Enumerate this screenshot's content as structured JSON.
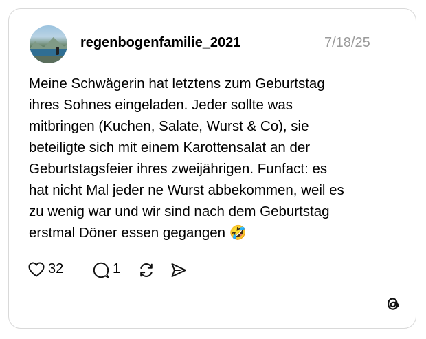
{
  "post": {
    "username": "regenbogenfamilie_2021",
    "date": "7/18/25",
    "text_lines": [
      "Meine Schwägerin hat letztens zum Geburtstag",
      "ihres Sohnes eingeladen. Jeder sollte was",
      "mitbringen (Kuchen, Salate, Wurst & Co), sie",
      "beteiligte sich mit einem Karottensalat an der",
      "Geburtstagsfeier ihres zweijährigen. Funfact: es",
      "hat nicht Mal jeder ne Wurst abbekommen, weil es",
      "zu wenig war und wir sind nach dem Geburtstag",
      "erstmal Döner essen gegangen 🤣"
    ]
  },
  "actions": {
    "likes": "32",
    "replies": "1"
  },
  "icons": {
    "like": "heart-icon",
    "reply": "comment-icon",
    "repost": "repost-icon",
    "share": "share-icon",
    "brand": "threads-logo-icon"
  }
}
